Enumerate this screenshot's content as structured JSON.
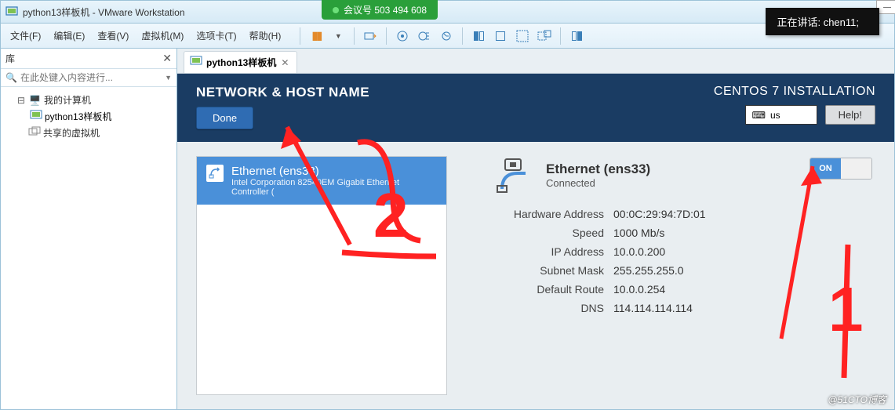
{
  "titlebar": {
    "title": "python13样板机 - VMware Workstation"
  },
  "meeting": {
    "label": "会议号 503 494 608"
  },
  "presenter": {
    "label": "正在讲话: chen11;"
  },
  "menu": {
    "file": "文件(F)",
    "edit": "编辑(E)",
    "view": "查看(V)",
    "vm": "虚拟机(M)",
    "tabs": "选项卡(T)",
    "help": "帮助(H)"
  },
  "sidebar": {
    "title": "库",
    "searchPlaceholder": "在此处键入内容进行...",
    "tree": {
      "root": "我的计算机",
      "child": "python13样板机",
      "shared": "共享的虚拟机"
    }
  },
  "tab": {
    "label": "python13样板机"
  },
  "installer": {
    "heading": "NETWORK & HOST NAME",
    "done": "Done",
    "title": "CENTOS 7 INSTALLATION",
    "keyboard": "us",
    "help": "Help!"
  },
  "network": {
    "listItem": {
      "title": "Ethernet (ens33)",
      "subtitle": "Intel Corporation 82540EM Gigabit Ethernet Controller ("
    },
    "detail": {
      "name": "Ethernet (ens33)",
      "status": "Connected",
      "rows": [
        {
          "label": "Hardware Address",
          "value": "00:0C:29:94:7D:01"
        },
        {
          "label": "Speed",
          "value": "1000 Mb/s"
        },
        {
          "label": "IP Address",
          "value": "10.0.0.200"
        },
        {
          "label": "Subnet Mask",
          "value": "255.255.255.0"
        },
        {
          "label": "Default Route",
          "value": "10.0.0.254"
        },
        {
          "label": "DNS",
          "value": "114.114.114.114"
        }
      ],
      "toggle": "ON"
    }
  },
  "annotations": {
    "a1": "1",
    "a2": "2"
  },
  "watermark": "@51CTO博客"
}
